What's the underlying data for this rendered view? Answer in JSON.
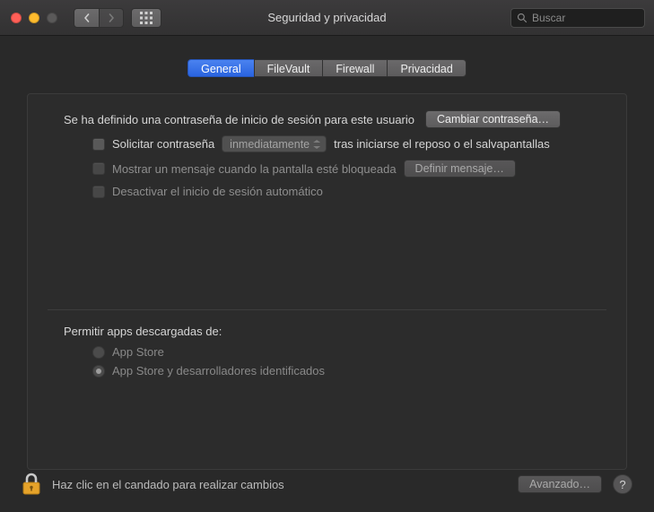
{
  "window": {
    "title": "Seguridad y privacidad",
    "search_placeholder": "Buscar"
  },
  "tabs": {
    "general": "General",
    "filevault": "FileVault",
    "firewall": "Firewall",
    "privacy": "Privacidad"
  },
  "general_pane": {
    "password_defined_line": "Se ha definido una contraseña de inicio de sesión para este usuario",
    "change_password_btn": "Cambiar contraseña…",
    "require_pw_label": "Solicitar contraseña",
    "require_pw_delay": "inmediatamente",
    "require_pw_suffix": "tras iniciarse el reposo o el salvapantallas",
    "show_message_label": "Mostrar un mensaje cuando la pantalla esté bloqueada",
    "set_message_btn": "Definir mensaje…",
    "disable_autologin": "Desactivar el inicio de sesión automático",
    "allow_apps_title": "Permitir apps descargadas de:",
    "radio_appstore": "App Store",
    "radio_identified": "App Store y desarrolladores identificados"
  },
  "footer": {
    "lock_hint": "Haz clic en el candado para realizar cambios",
    "advanced_btn": "Avanzado…"
  }
}
